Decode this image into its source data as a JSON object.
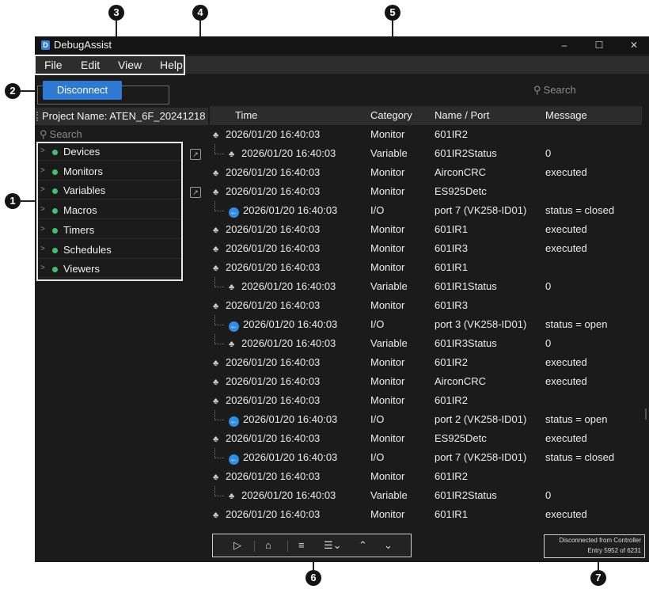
{
  "window": {
    "title": "DebugAssist",
    "controls": [
      "–",
      "☐",
      "✕"
    ]
  },
  "menu": [
    "File",
    "Edit",
    "View",
    "Help"
  ],
  "toolbar_top": {
    "disconnect_label": "Disconnect",
    "search_placeholder": "Search"
  },
  "project": {
    "header": "Project Name: ATEN_6F_20241218",
    "search_placeholder": "Search",
    "tree": [
      {
        "label": "Devices",
        "popout": true
      },
      {
        "label": "Monitors",
        "popout": false
      },
      {
        "label": "Variables",
        "popout": true
      },
      {
        "label": "Macros",
        "popout": false
      },
      {
        "label": "Timers",
        "popout": false
      },
      {
        "label": "Schedules",
        "popout": false
      },
      {
        "label": "Viewers",
        "popout": false
      }
    ]
  },
  "log": {
    "columns": [
      "Time",
      "Category",
      "Name / Port",
      "Message"
    ],
    "rows": [
      {
        "indent": false,
        "icon": "network-icon",
        "time": "2026/01/20 16:40:03",
        "category": "Monitor",
        "name": "601IR2",
        "message": ""
      },
      {
        "indent": true,
        "icon": "network-icon",
        "time": "2026/01/20 16:40:03",
        "category": "Variable",
        "name": "601IR2Status",
        "message": "0"
      },
      {
        "indent": false,
        "icon": "network-icon",
        "time": "2026/01/20 16:40:03",
        "category": "Monitor",
        "name": "AirconCRC",
        "message": "executed"
      },
      {
        "indent": false,
        "icon": "network-icon",
        "time": "2026/01/20 16:40:03",
        "category": "Monitor",
        "name": "ES925Detc",
        "message": ""
      },
      {
        "indent": true,
        "icon": "io-icon",
        "time": "2026/01/20 16:40:03",
        "category": "I/O",
        "name": "port 7 (VK258-ID01)",
        "message": "status = closed"
      },
      {
        "indent": false,
        "icon": "network-icon",
        "time": "2026/01/20 16:40:03",
        "category": "Monitor",
        "name": "601IR1",
        "message": "executed"
      },
      {
        "indent": false,
        "icon": "network-icon",
        "time": "2026/01/20 16:40:03",
        "category": "Monitor",
        "name": "601IR3",
        "message": "executed"
      },
      {
        "indent": false,
        "icon": "network-icon",
        "time": "2026/01/20 16:40:03",
        "category": "Monitor",
        "name": "601IR1",
        "message": ""
      },
      {
        "indent": true,
        "icon": "network-icon",
        "time": "2026/01/20 16:40:03",
        "category": "Variable",
        "name": "601IR1Status",
        "message": "0"
      },
      {
        "indent": false,
        "icon": "network-icon",
        "time": "2026/01/20 16:40:03",
        "category": "Monitor",
        "name": "601IR3",
        "message": ""
      },
      {
        "indent": true,
        "icon": "io-icon",
        "time": "2026/01/20 16:40:03",
        "category": "I/O",
        "name": "port 3 (VK258-ID01)",
        "message": "status = open"
      },
      {
        "indent": true,
        "icon": "network-icon",
        "time": "2026/01/20 16:40:03",
        "category": "Variable",
        "name": "601IR3Status",
        "message": "0"
      },
      {
        "indent": false,
        "icon": "network-icon",
        "time": "2026/01/20 16:40:03",
        "category": "Monitor",
        "name": "601IR2",
        "message": "executed"
      },
      {
        "indent": false,
        "icon": "network-icon",
        "time": "2026/01/20 16:40:03",
        "category": "Monitor",
        "name": "AirconCRC",
        "message": "executed"
      },
      {
        "indent": false,
        "icon": "network-icon",
        "time": "2026/01/20 16:40:03",
        "category": "Monitor",
        "name": "601IR2",
        "message": ""
      },
      {
        "indent": true,
        "icon": "io-icon",
        "time": "2026/01/20 16:40:03",
        "category": "I/O",
        "name": "port 2 (VK258-ID01)",
        "message": "status = open"
      },
      {
        "indent": false,
        "icon": "network-icon",
        "time": "2026/01/20 16:40:03",
        "category": "Monitor",
        "name": "ES925Detc",
        "message": "executed"
      },
      {
        "indent": true,
        "icon": "io-icon",
        "time": "2026/01/20 16:40:03",
        "category": "I/O",
        "name": "port 7 (VK258-ID01)",
        "message": "status = closed"
      },
      {
        "indent": false,
        "icon": "network-icon",
        "time": "2026/01/20 16:40:03",
        "category": "Monitor",
        "name": "601IR2",
        "message": ""
      },
      {
        "indent": true,
        "icon": "network-icon",
        "time": "2026/01/20 16:40:03",
        "category": "Variable",
        "name": "601IR2Status",
        "message": "0"
      },
      {
        "indent": false,
        "icon": "network-icon",
        "time": "2026/01/20 16:40:03",
        "category": "Monitor",
        "name": "601IR1",
        "message": "executed"
      }
    ]
  },
  "bottom_toolbar": {
    "buttons": [
      "play-icon",
      "clear-icon",
      "wrap-icon",
      "filter-icon",
      "up-icon",
      "down-icon"
    ]
  },
  "status": {
    "line1": "Disconnected from Controller",
    "line2": "Entry  5952  of 6231"
  },
  "callouts": [
    "1",
    "2",
    "3",
    "4",
    "5",
    "6",
    "7"
  ]
}
